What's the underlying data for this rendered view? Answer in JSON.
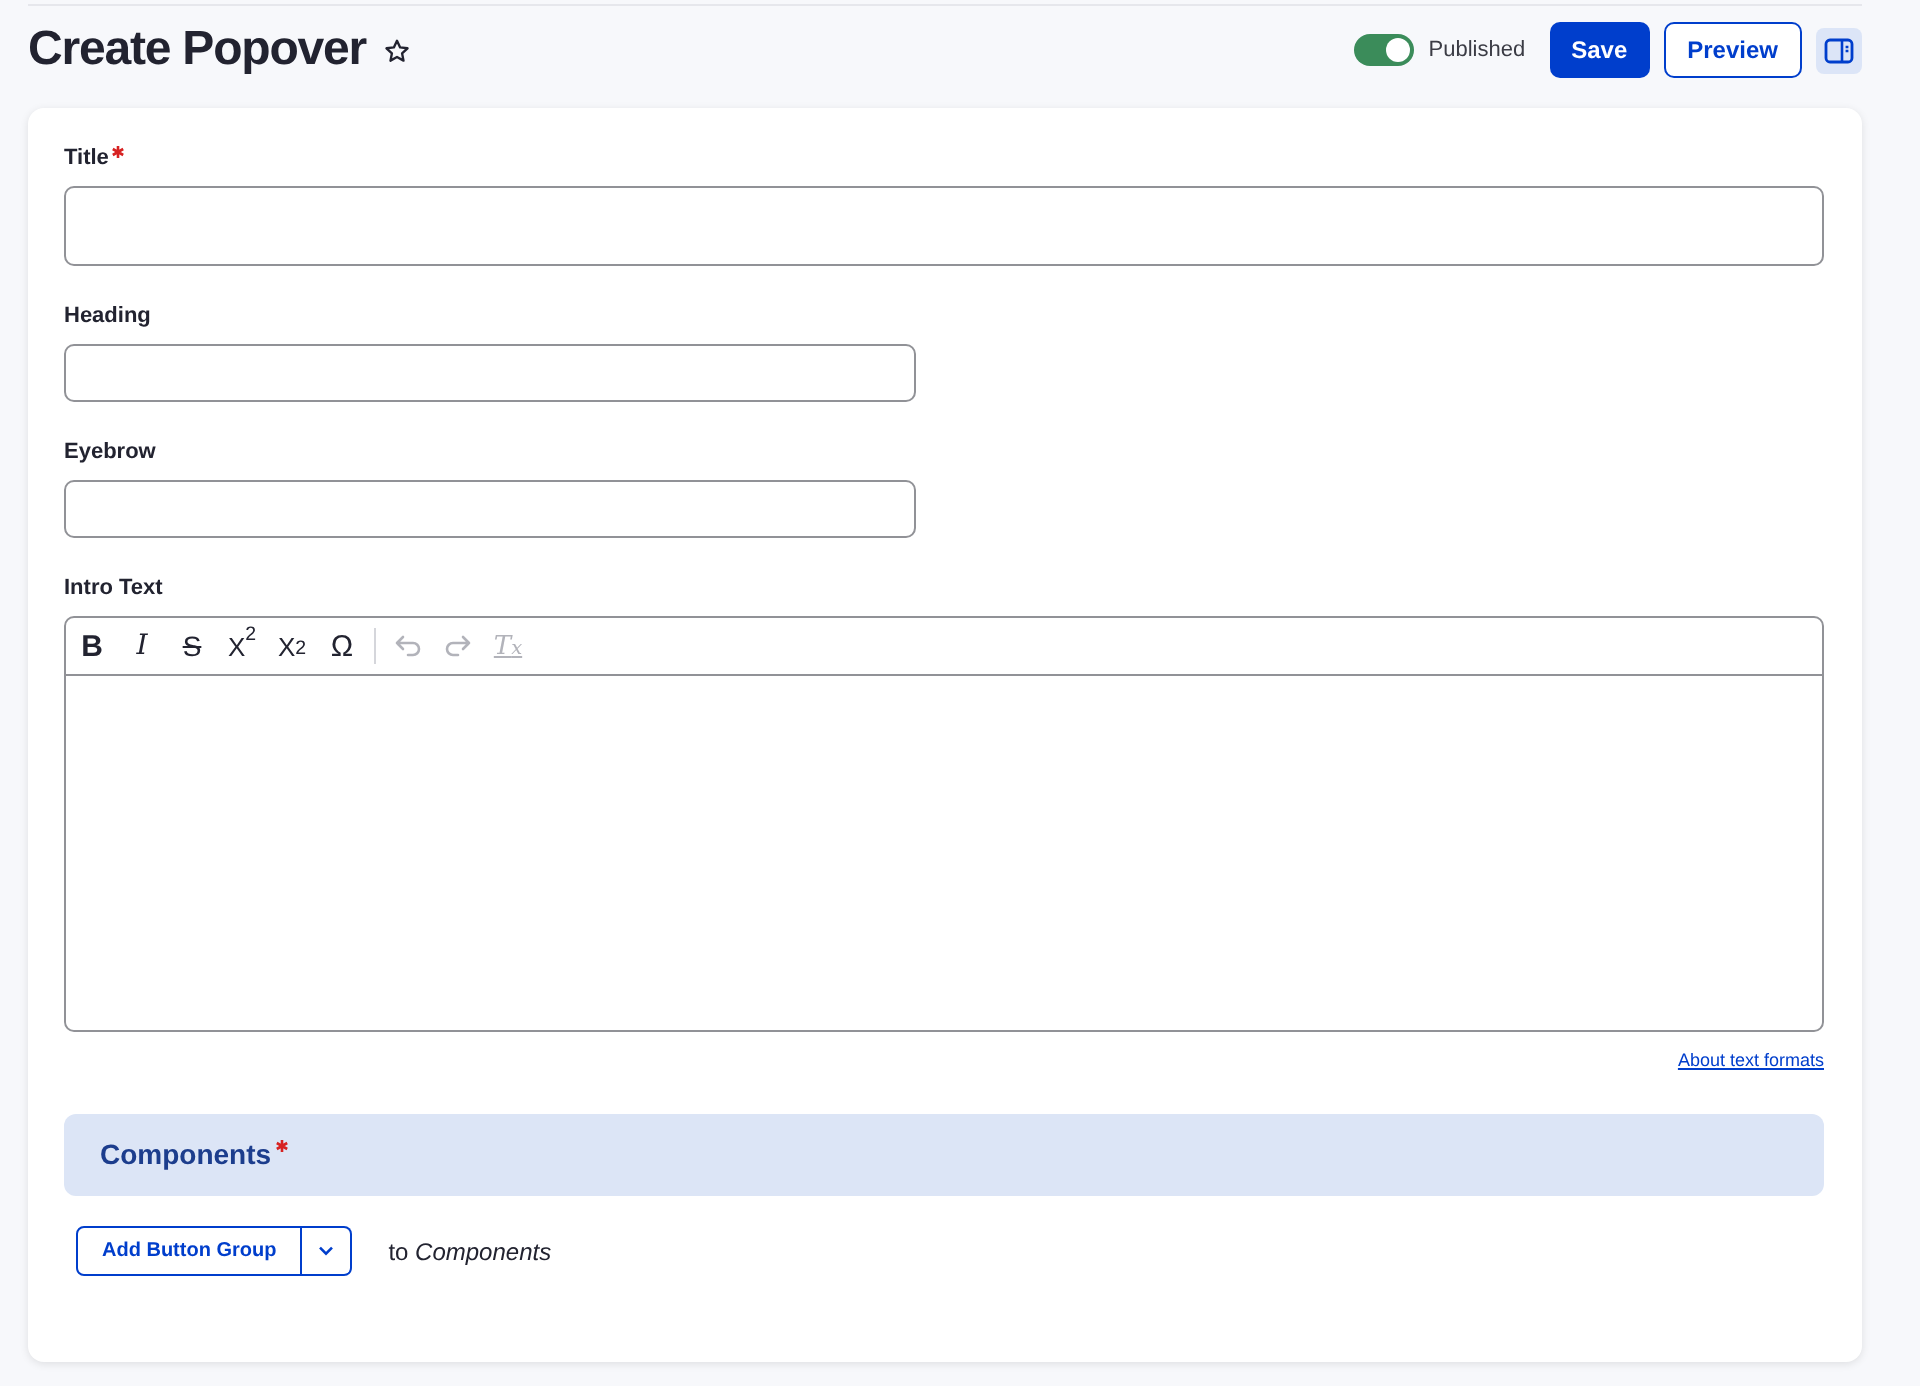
{
  "header": {
    "title": "Create Popover",
    "starred": false,
    "status": {
      "label": "Published",
      "on": true
    },
    "buttons": [
      {
        "label": "Save",
        "kind": "primary"
      },
      {
        "label": "Preview",
        "kind": "secondary"
      }
    ]
  },
  "form": {
    "fields": [
      {
        "label": "Title",
        "required": true,
        "kind": "title"
      },
      {
        "label": "Heading",
        "required": false,
        "kind": "text"
      },
      {
        "label": "Eyebrow",
        "required": false,
        "kind": "text"
      },
      {
        "label": "Intro Text",
        "required": false,
        "kind": "editor",
        "toolbar": [
          [
            {
              "kind": "bold",
              "glyph": "B",
              "disabled": false
            },
            {
              "kind": "italic",
              "glyph": "I",
              "disabled": false
            },
            {
              "kind": "strikethrough",
              "glyph": "S",
              "disabled": false
            },
            {
              "kind": "superscript",
              "glyph": "X$^{2}$",
              "disabled": false
            },
            {
              "kind": "subscript",
              "glyph": "X$_{2}$",
              "disabled": false
            },
            {
              "kind": "special-characters",
              "glyph": "Ω",
              "disabled": false
            }
          ],
          [
            {
              "kind": "undo",
              "disabled": true
            },
            {
              "kind": "redo",
              "disabled": true
            },
            {
              "kind": "remove-format",
              "glyph": "T$_{x}$",
              "disabled": true
            }
          ]
        ],
        "help_link": "About text formats"
      }
    ]
  },
  "components": {
    "title": "Components",
    "required": true,
    "add_button": "Add Button Group",
    "add_target": "to *Components*"
  }
}
